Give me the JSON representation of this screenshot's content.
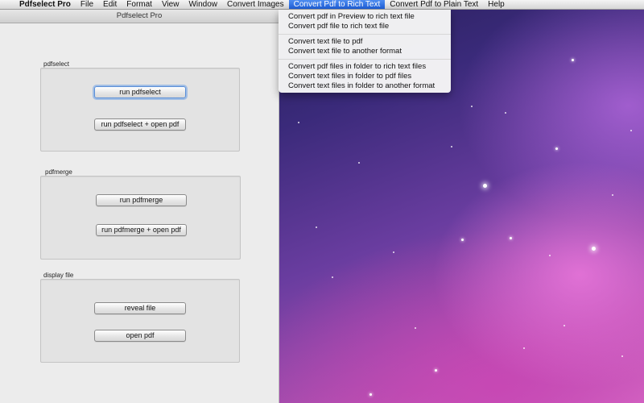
{
  "menubar": {
    "apple_glyph": "",
    "app_name": "Pdfselect Pro",
    "items": [
      "File",
      "Edit",
      "Format",
      "View",
      "Window",
      "Convert Images",
      "Convert Pdf to Rich Text",
      "Convert Pdf to Plain Text",
      "Help"
    ],
    "active_item": "Convert Pdf to Rich Text"
  },
  "dropdown": {
    "items": [
      "Convert pdf in Preview to rich text file",
      "Convert pdf file to rich text file",
      "Convert text file to pdf",
      "Convert text file to another format",
      "Convert pdf files in folder to rich text files",
      "Convert text files in folder to pdf files",
      "Convert text files in folder to another format"
    ]
  },
  "window": {
    "title": "Pdfselect Pro",
    "groups": {
      "pdfselect": {
        "label": "pdfselect",
        "buttons": [
          "run pdfselect",
          "run pdfselect + open pdf"
        ]
      },
      "pdfmerge": {
        "label": "pdfmerge",
        "buttons": [
          "run pdfmerge",
          "run pdfmerge + open pdf"
        ]
      },
      "display": {
        "label": "display file",
        "buttons": [
          "reveal file",
          "open pdf"
        ]
      }
    }
  },
  "colors": {
    "menu_highlight": "#2f6fe0",
    "window_bg": "#ececec",
    "desktop_purple": "#6a3da0",
    "desktop_pink": "#d86fc8"
  }
}
